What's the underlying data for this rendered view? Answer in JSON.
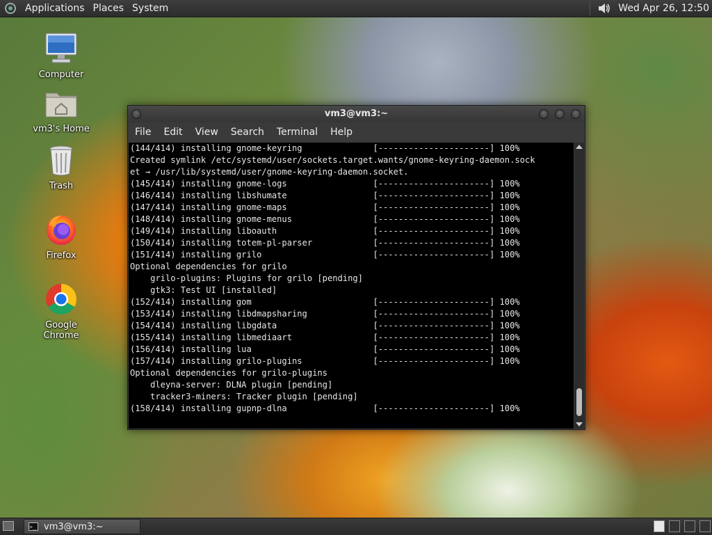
{
  "top_panel": {
    "menus": [
      "Applications",
      "Places",
      "System"
    ],
    "clock": "Wed Apr 26, 12:50"
  },
  "desktop_icons": [
    {
      "label": "Computer",
      "icon": "computer-icon"
    },
    {
      "label": "vm3's Home",
      "icon": "home-folder-icon"
    },
    {
      "label": "Trash",
      "icon": "trash-icon"
    },
    {
      "label": "Firefox",
      "icon": "firefox-icon"
    },
    {
      "label": "Google Chrome",
      "icon": "chrome-icon"
    }
  ],
  "terminal": {
    "title": "vm3@vm3:~",
    "menu": [
      "File",
      "Edit",
      "View",
      "Search",
      "Terminal",
      "Help"
    ],
    "lines": [
      "(144/414) installing gnome-keyring              [----------------------] 100%",
      "Created symlink /etc/systemd/user/sockets.target.wants/gnome-keyring-daemon.sock",
      "et → /usr/lib/systemd/user/gnome-keyring-daemon.socket.",
      "(145/414) installing gnome-logs                 [----------------------] 100%",
      "(146/414) installing libshumate                 [----------------------] 100%",
      "(147/414) installing gnome-maps                 [----------------------] 100%",
      "(148/414) installing gnome-menus                [----------------------] 100%",
      "(149/414) installing liboauth                   [----------------------] 100%",
      "(150/414) installing totem-pl-parser            [----------------------] 100%",
      "(151/414) installing grilo                      [----------------------] 100%",
      "Optional dependencies for grilo",
      "    grilo-plugins: Plugins for grilo [pending]",
      "    gtk3: Test UI [installed]",
      "(152/414) installing gom                        [----------------------] 100%",
      "(153/414) installing libdmapsharing             [----------------------] 100%",
      "(154/414) installing libgdata                   [----------------------] 100%",
      "(155/414) installing libmediaart                [----------------------] 100%",
      "(156/414) installing lua                        [----------------------] 100%",
      "(157/414) installing grilo-plugins              [----------------------] 100%",
      "Optional dependencies for grilo-plugins",
      "    dleyna-server: DLNA plugin [pending]",
      "    tracker3-miners: Tracker plugin [pending]",
      "(158/414) installing gupnp-dlna                 [----------------------] 100%"
    ]
  },
  "taskbar": {
    "task_label": "vm3@vm3:~"
  },
  "colors": {
    "panel": "#333333",
    "terminal_bg": "#000000",
    "terminal_fg": "#e6e6e6"
  }
}
